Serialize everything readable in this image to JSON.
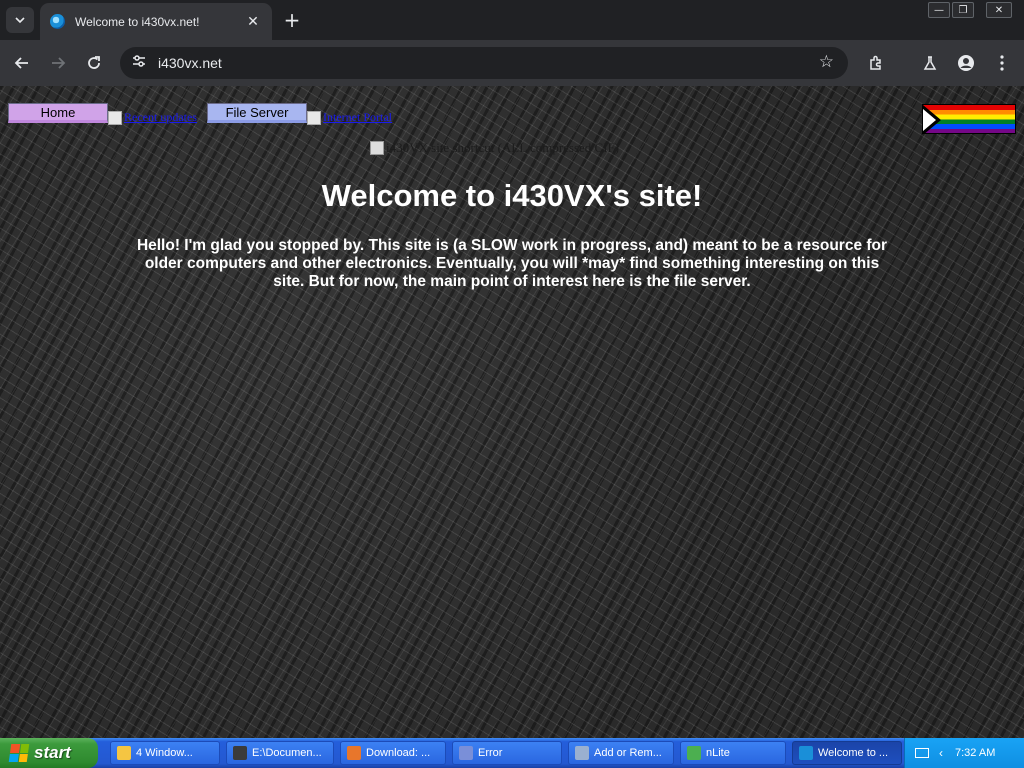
{
  "browser": {
    "tab_title": "Welcome to i430vx.net!",
    "url": "i430vx.net",
    "tab_close": "✕",
    "new_tab": "+",
    "window_controls": [
      "—",
      "❐",
      "✕"
    ]
  },
  "page": {
    "nav": {
      "home": "Home",
      "file_server": "File Server",
      "broken1_alt": "Recent updates",
      "broken2_alt": "Internet Portal"
    },
    "banner_alt": "i430VX site shortcut (ALL compressed CIF)",
    "title": "Welcome to i430VX's site!",
    "intro": "Hello! I'm glad you stopped by. This site is (a SLOW work in progress, and) meant to be a resource for older computers and other electronics. Eventually, you will *may* find something interesting on this site. But for now, the main point of interest here is the file server.",
    "flag_colors": [
      "#e40303",
      "#ff8c00",
      "#ffed00",
      "#008026",
      "#004dff",
      "#750787"
    ]
  },
  "taskbar": {
    "start": "start",
    "tasks": [
      {
        "label": "4 Window...",
        "icon_color": "#f5c542"
      },
      {
        "label": "E:\\Documen...",
        "icon_color": "#3b3b3b"
      },
      {
        "label": "Download: ...",
        "icon_color": "#e8762b"
      },
      {
        "label": "Error",
        "icon_color": "#7a8fd8"
      },
      {
        "label": "Add or Rem...",
        "icon_color": "#9ab0d0"
      },
      {
        "label": "nLite",
        "icon_color": "#4caf50"
      },
      {
        "label": "Welcome to ...",
        "icon_color": "#1a8fd8"
      }
    ],
    "clock": "7:32 AM"
  }
}
